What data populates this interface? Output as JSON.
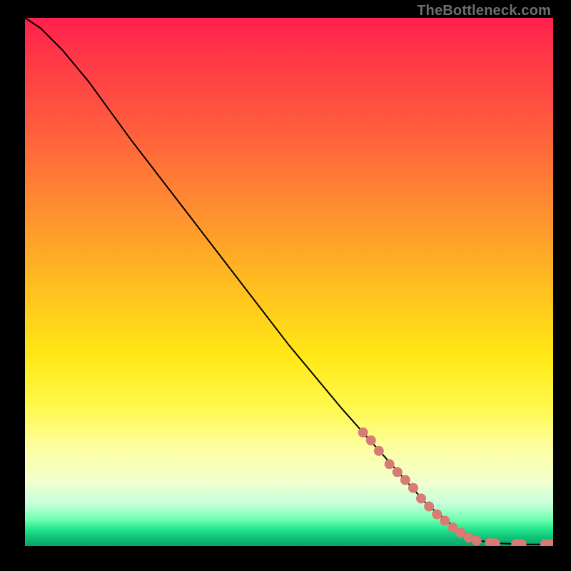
{
  "watermark": "TheBottleneck.com",
  "chart_data": {
    "type": "line",
    "title": "",
    "xlabel": "",
    "ylabel": "",
    "xlim": [
      0,
      100
    ],
    "ylim": [
      0,
      100
    ],
    "curve": [
      {
        "x": 0,
        "y": 100
      },
      {
        "x": 3,
        "y": 98
      },
      {
        "x": 7,
        "y": 94
      },
      {
        "x": 12,
        "y": 88
      },
      {
        "x": 20,
        "y": 77
      },
      {
        "x": 30,
        "y": 64
      },
      {
        "x": 40,
        "y": 51
      },
      {
        "x": 50,
        "y": 38
      },
      {
        "x": 60,
        "y": 26
      },
      {
        "x": 68,
        "y": 17
      },
      {
        "x": 76,
        "y": 8
      },
      {
        "x": 82,
        "y": 3
      },
      {
        "x": 86,
        "y": 1
      },
      {
        "x": 90,
        "y": 0.5
      },
      {
        "x": 95,
        "y": 0.3
      },
      {
        "x": 100,
        "y": 0.3
      }
    ],
    "markers": [
      {
        "x": 64,
        "y": 21.5
      },
      {
        "x": 65.5,
        "y": 20
      },
      {
        "x": 67,
        "y": 18
      },
      {
        "x": 69,
        "y": 15.5
      },
      {
        "x": 70.5,
        "y": 14
      },
      {
        "x": 72,
        "y": 12.5
      },
      {
        "x": 73.5,
        "y": 11
      },
      {
        "x": 75,
        "y": 9
      },
      {
        "x": 76.5,
        "y": 7.5
      },
      {
        "x": 78,
        "y": 6
      },
      {
        "x": 79.5,
        "y": 4.8
      },
      {
        "x": 81,
        "y": 3.5
      },
      {
        "x": 82.5,
        "y": 2.5
      },
      {
        "x": 84,
        "y": 1.6
      },
      {
        "x": 85.5,
        "y": 1.0
      },
      {
        "x": 88,
        "y": 0.6
      },
      {
        "x": 89,
        "y": 0.5
      },
      {
        "x": 93,
        "y": 0.4
      },
      {
        "x": 94,
        "y": 0.4
      },
      {
        "x": 98.5,
        "y": 0.35
      },
      {
        "x": 99.5,
        "y": 0.35
      }
    ],
    "marker_color": "#d77b74",
    "line_color": "#000000"
  }
}
